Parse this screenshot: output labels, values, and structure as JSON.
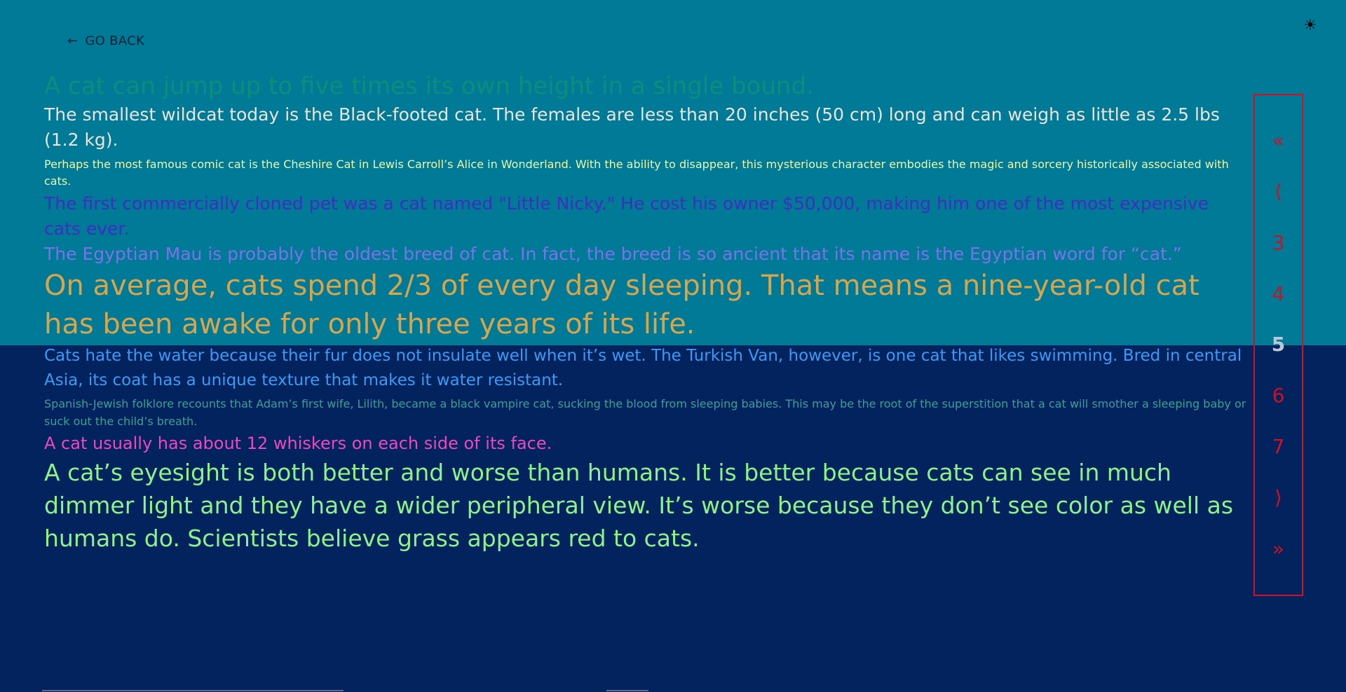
{
  "header": {
    "theme_toggle_icon": "☀",
    "go_back_label": "GO BACK",
    "go_back_icon": "←"
  },
  "facts": [
    "A cat can jump up to five times its own height in a single bound.",
    "The smallest wildcat today is the Black-footed cat. The females are less than 20 inches (50 cm) long and can weigh as little as 2.5 lbs (1.2 kg).",
    "Perhaps the most famous comic cat is the Cheshire Cat in Lewis Carroll’s Alice in Wonderland. With the ability to disappear, this mysterious character embodies the magic and sorcery historically associated with cats.",
    "The first commercially cloned pet was a cat named \"Little Nicky.\" He cost his owner $50,000, making him one of the most expensive cats ever.",
    "The Egyptian Mau is probably the oldest breed of cat. In fact, the breed is so ancient that its name is the Egyptian word for “cat.”",
    "On average, cats spend 2/3 of every day sleeping. That means a nine-year-old cat has been awake for only three years of its life.",
    "Cats hate the water because their fur does not insulate well when it’s wet. The Turkish Van, however, is one cat that likes swimming. Bred in central Asia, its coat has a unique texture that makes it water resistant.",
    "Spanish-Jewish folklore recounts that Adam’s first wife, Lilith, became a black vampire cat, sucking the blood from sleeping babies. This may be the root of the superstition that a cat will smother a sleeping baby or suck out the child’s breath.",
    "A cat usually has about 12 whiskers on each side of its face.",
    "A cat’s eyesight is both better and worse than humans. It is better because cats can see in much dimmer light and they have a wider peripheral view. It’s worse because they don’t see color as well as humans do. Scientists believe grass appears red to cats."
  ],
  "pagination": {
    "first": "«",
    "prev": "⟨",
    "pages": [
      "3",
      "4",
      "5",
      "6",
      "7"
    ],
    "current": "5",
    "next": "⟩",
    "last": "»"
  },
  "colors": {
    "top_band": "#007a96",
    "bottom_band": "#03235e",
    "pagination_accent": "#d40f22"
  }
}
